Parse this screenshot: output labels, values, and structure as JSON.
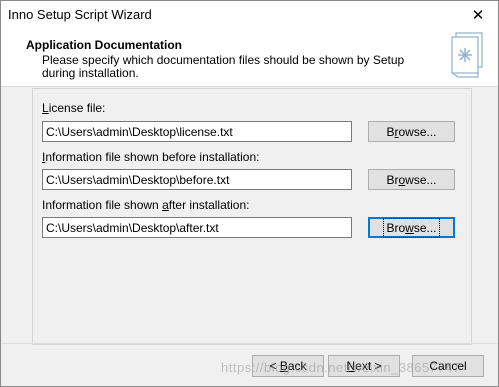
{
  "window": {
    "title": "Inno Setup Script Wizard",
    "close_glyph": "✕"
  },
  "header": {
    "title": "Application Documentation",
    "description": "Please specify which documentation files should be shown by Setup during installation.",
    "icon": "documentation-book-icon"
  },
  "fields": {
    "license": {
      "label_pre": "",
      "label_ul": "L",
      "label_post": "icense file:",
      "value": "C:\\Users\\admin\\Desktop\\license.txt",
      "browse_pre": "B",
      "browse_ul": "r",
      "browse_post": "owse..."
    },
    "before": {
      "label_pre": "",
      "label_ul": "I",
      "label_post": "nformation file shown before installation:",
      "value": "C:\\Users\\admin\\Desktop\\before.txt",
      "browse_pre": "Br",
      "browse_ul": "o",
      "browse_post": "wse..."
    },
    "after": {
      "label_pre": "Information file shown ",
      "label_ul": "a",
      "label_post": "fter installation:",
      "value": "C:\\Users\\admin\\Desktop\\after.txt",
      "browse_pre": "Bro",
      "browse_ul": "w",
      "browse_post": "se..."
    }
  },
  "footer": {
    "back_pre": "< ",
    "back_ul": "B",
    "back_post": "ack",
    "next_pre": "",
    "next_ul": "N",
    "next_post": "ext >",
    "cancel": "Cancel",
    "watermark": "https://blog.csdn.net/weixin_38657747"
  },
  "colors": {
    "focus_border": "#0078d7",
    "button_face": "#e1e1e1",
    "panel_bg": "#f0f0f0"
  }
}
